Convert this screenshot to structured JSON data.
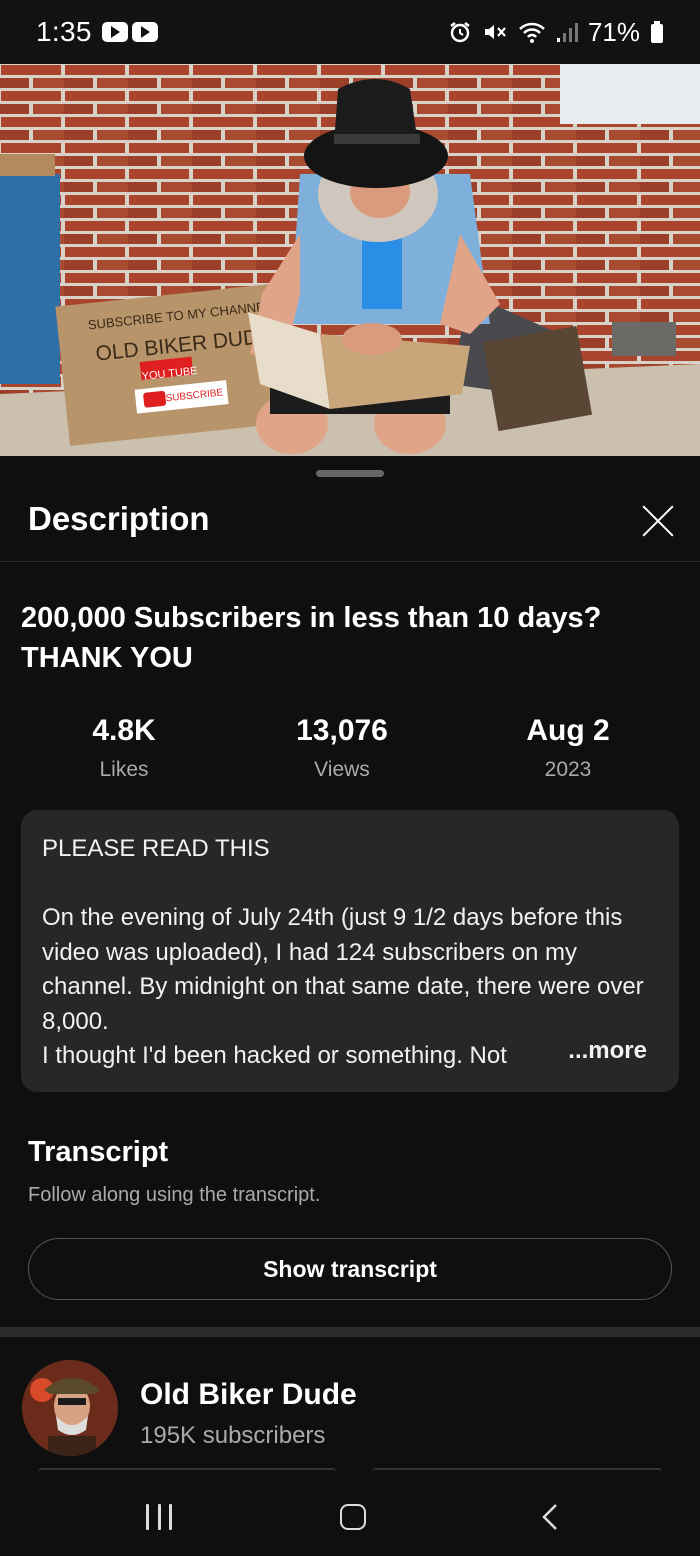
{
  "status_bar": {
    "time": "1:35",
    "battery": "71%",
    "icons": [
      "youtube-icon",
      "youtube-icon",
      "alarm-icon",
      "mute-icon",
      "wifi-icon",
      "signal-icon",
      "battery-icon"
    ]
  },
  "video_thumbnail": {
    "sign_text": [
      "SUBSCRIBE TO MY CHANNEL",
      "OLD BIKER DUDE",
      "YOU TUBE",
      "SUBSCRIBE"
    ]
  },
  "sheet": {
    "title": "Description",
    "close_icon": "close-icon"
  },
  "video": {
    "title": "200,000 Subscribers in less than 10 days? THANK YOU",
    "stats": [
      {
        "value": "4.8K",
        "label": "Likes"
      },
      {
        "value": "13,076",
        "label": "Views"
      },
      {
        "value": "Aug 2",
        "label": "2023"
      }
    ],
    "description": "PLEASE READ THIS\n\nOn the evening of July 24th (just 9 1/2 days before this video was uploaded), I had 124 subscribers on my channel. By midnight on that same date, there were over 8,000.\nI thought I'd been hacked or something. Not",
    "more_label": "...more"
  },
  "transcript": {
    "title": "Transcript",
    "subtitle": "Follow along using the transcript.",
    "button_label": "Show transcript"
  },
  "channel": {
    "name": "Old Biker Dude",
    "subscribers": "195K subscribers"
  },
  "nav_bar": {
    "icons": [
      "recents-icon",
      "home-icon",
      "back-icon"
    ]
  },
  "colors": {
    "background": "#0f0f0f",
    "card": "#272727",
    "secondary_text": "#aaaaaa",
    "brick": "#a1452f"
  }
}
